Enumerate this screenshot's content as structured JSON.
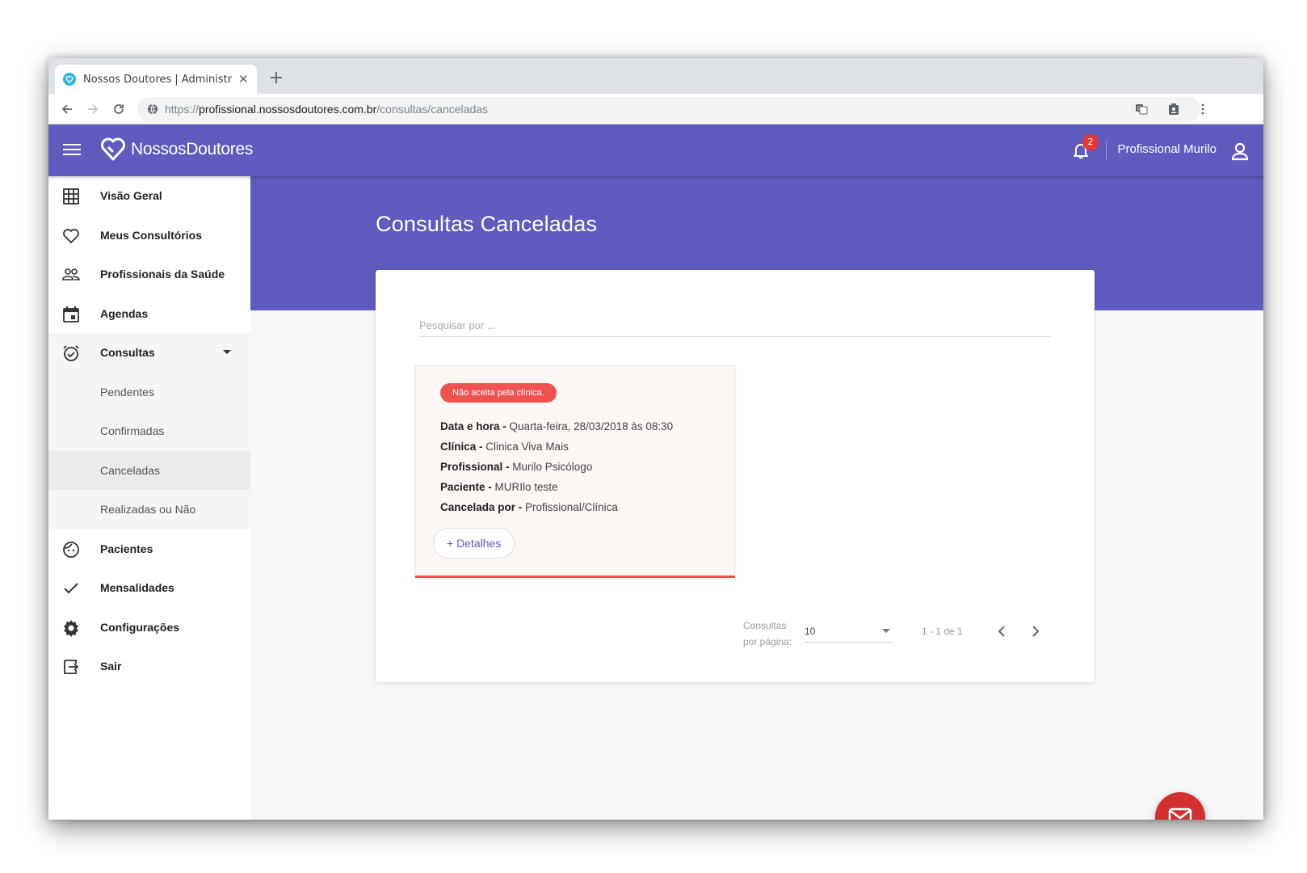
{
  "browser": {
    "tab_title": "Nossos Doutores | Administraç",
    "url_scheme": "https://",
    "url_host": "profissional.nossosdoutores.com.br",
    "url_path": "/consultas/canceladas"
  },
  "app": {
    "brand": "NossosDoutores",
    "notification_count": "2",
    "user_name": "Profissional Murilo",
    "colors": {
      "primary": "#5f5bbf",
      "danger": "#ef5350",
      "fab": "#d32f2f"
    }
  },
  "sidebar": {
    "items": [
      {
        "label": "Visão Geral",
        "icon": "grid-icon"
      },
      {
        "label": "Meus Consultórios",
        "icon": "heart-icon"
      },
      {
        "label": "Profissionais da Saúde",
        "icon": "people-icon"
      },
      {
        "label": "Agendas",
        "icon": "calendar-icon"
      },
      {
        "label": "Consultas",
        "icon": "alarm-check-icon"
      },
      {
        "label": "Pacientes",
        "icon": "face-icon"
      },
      {
        "label": "Mensalidades",
        "icon": "check-icon"
      },
      {
        "label": "Configurações",
        "icon": "gear-icon"
      },
      {
        "label": "Sair",
        "icon": "logout-icon"
      }
    ],
    "consultas_sub": [
      {
        "label": "Pendentes"
      },
      {
        "label": "Confirmadas"
      },
      {
        "label": "Canceladas"
      },
      {
        "label": "Realizadas ou Não"
      }
    ]
  },
  "main": {
    "title": "Consultas Canceladas",
    "search_placeholder": "Pesquisar por ...",
    "card": {
      "status": "Não aceita pela clínica.",
      "rows": [
        {
          "label": "Data e hora -",
          "value": "Quarta-feira, 28/03/2018 às 08:30"
        },
        {
          "label": "Clínica -",
          "value": "Clinica Viva Mais"
        },
        {
          "label": "Profissional -",
          "value": "Murilo Psicólogo"
        },
        {
          "label": "Paciente -",
          "value": "MURIlo teste"
        },
        {
          "label": "Cancelada por -",
          "value": "Profissional/Clínica"
        }
      ],
      "details_button": "+ Detalhes"
    },
    "pagination": {
      "per_page_label_1": "Consultas",
      "per_page_label_2": "por página:",
      "per_page_value": "10",
      "range": "1 - 1 de 1"
    }
  }
}
